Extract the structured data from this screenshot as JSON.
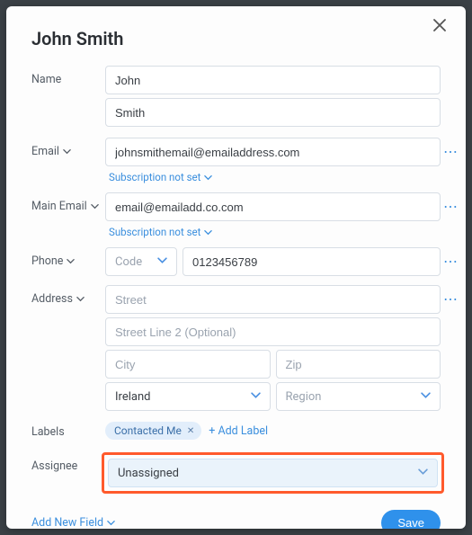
{
  "header": {
    "title": "John Smith"
  },
  "labels_text": {
    "name": "Name",
    "email": "Email",
    "main_email": "Main Email",
    "phone": "Phone",
    "address": "Address",
    "labels": "Labels",
    "assignee": "Assignee"
  },
  "name": {
    "first": "John",
    "last": "Smith"
  },
  "email": {
    "value": "johnsmithemail@emailaddress.com",
    "sub": "Subscription not set"
  },
  "main_email": {
    "value": "email@emailadd.co.com",
    "sub": "Subscription not set"
  },
  "phone": {
    "code_placeholder": "Code",
    "number": "0123456789"
  },
  "address": {
    "street_ph": "Street",
    "street2_ph": "Street Line 2 (Optional)",
    "city_ph": "City",
    "zip_ph": "Zip",
    "country": "Ireland",
    "region_ph": "Region"
  },
  "tags": {
    "chip": "Contacted Me",
    "add": "+ Add Label"
  },
  "assignee": {
    "value": "Unassigned"
  },
  "footer": {
    "add_field": "Add New Field",
    "save": "Save"
  }
}
